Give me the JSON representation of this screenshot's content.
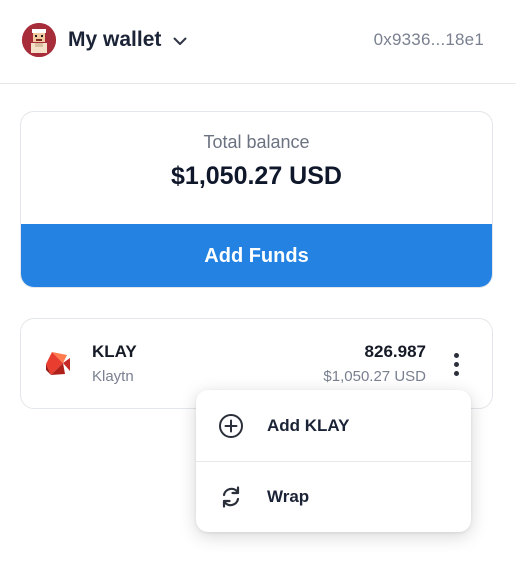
{
  "header": {
    "wallet_name": "My wallet",
    "address": "0x9336...18e1",
    "avatar_icon": "pixel-avatar-icon",
    "chevron_icon": "chevron-down-icon"
  },
  "balance": {
    "label": "Total balance",
    "value": "$1,050.27 USD",
    "add_funds_label": "Add Funds",
    "accent_color": "#2382e2"
  },
  "tokens": [
    {
      "symbol": "KLAY",
      "name": "Klaytn",
      "amount": "826.987",
      "usd_value": "$1,050.27 USD",
      "logo_icon": "klaytn-logo-icon",
      "menu_icon": "more-vertical-icon"
    }
  ],
  "token_menu": {
    "items": [
      {
        "label": "Add KLAY",
        "icon": "plus-circle-icon"
      },
      {
        "label": "Wrap",
        "icon": "refresh-icon"
      }
    ]
  }
}
